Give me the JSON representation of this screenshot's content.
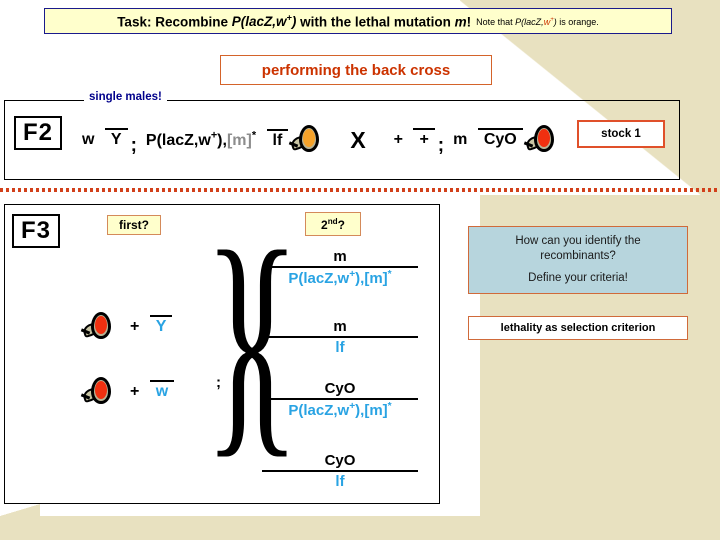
{
  "slide": {
    "task_banner": {
      "label_bold": "Task:",
      "text_part1": " Recombine ",
      "gene_italic": "P(lacZ,",
      "gene_italic_w": "w",
      "gene_sup": "+",
      "gene_close": ")",
      "text_part2": " with the lethal mutation ",
      "mutation_italic": "m",
      "text_excl": "!",
      "note_prefix": "Note that ",
      "note_gene": "P(lacZ,",
      "note_gene_w": "w",
      "note_gene_sup": "+",
      "note_gene_close": ")",
      "note_suffix": " is orange."
    },
    "backcross_banner": "performing the back cross"
  },
  "f2": {
    "tag": "F2",
    "legend": "single males!",
    "left_genotype": {
      "chrom1_num": "w",
      "chrom1_den": "Y",
      "separator": ";",
      "chrom2_num_a": "P(lacZ,w",
      "chrom2_num_sup": "+",
      "chrom2_num_b": "),",
      "chrom2_num_grey": "[m]",
      "chrom2_num_star": "*",
      "chrom2_den": "lf"
    },
    "cross_symbol": "X",
    "right_genotype": {
      "chrom1_num": "+",
      "chrom1_den": "+",
      "separator": ";",
      "chrom2_num": "m",
      "chrom2_den": "CyO"
    },
    "stock_label": "stock 1",
    "fly_left": "fly-icon-orange-eye",
    "fly_right": "fly-icon-red-eye"
  },
  "f3": {
    "tag": "F3",
    "first_question": "first?",
    "second_question": "2nd?",
    "brace_semicolon": ";",
    "left_column": [
      {
        "fly": "fly-icon-red-eye",
        "num": "+",
        "den": "Y"
      },
      {
        "fly": "fly-icon-red-eye",
        "num": "+",
        "den": "w"
      }
    ],
    "right_column": [
      {
        "num": "m",
        "den_a": "P(lacZ,w",
        "den_sup": "+",
        "den_b": "),[m]",
        "den_star": "*",
        "den_plain": null
      },
      {
        "num": "m",
        "den_plain": "lf"
      },
      {
        "num": "CyO",
        "den_a": "P(lacZ,w",
        "den_sup": "+",
        "den_b": "),[m]",
        "den_star": "*",
        "den_plain": null
      },
      {
        "num": "CyO",
        "den_plain": "lf"
      }
    ]
  },
  "right_panel": {
    "identify_line1": "How can you identify  the",
    "identify_line2": "recombinants?",
    "identify_line3": "Define your criteria!",
    "criterion": "lethality as selection criterion"
  },
  "colors": {
    "banner_bg": "#ffffcc",
    "banner_border": "#1a1a8c",
    "accent_orange": "#cc3300",
    "blue_text": "#29a3e3",
    "legend_blue": "#00008b",
    "beige_bg": "#e8e1c0",
    "teal_box": "#b7d5dd",
    "stock_border": "#e0502a",
    "fly_orange_eye": "#f5a22a",
    "fly_red_eye": "#f03010"
  }
}
